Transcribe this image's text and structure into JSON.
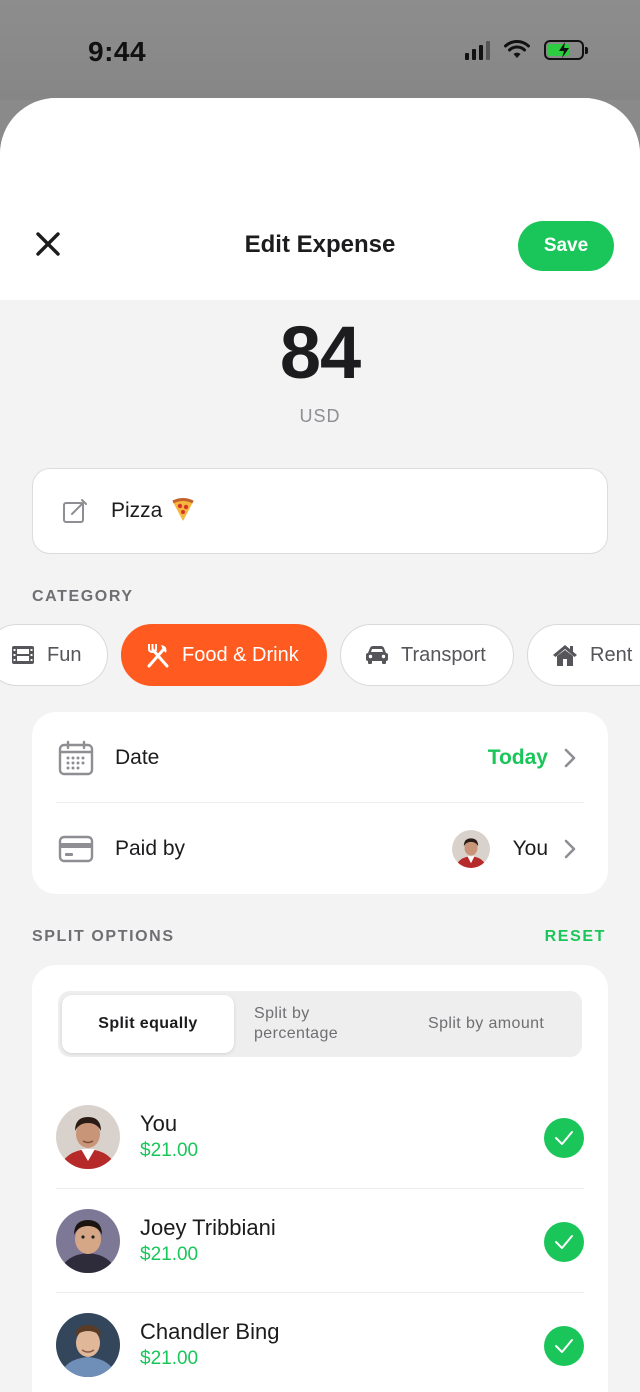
{
  "status_bar": {
    "time": "9:44"
  },
  "header": {
    "title": "Edit Expense",
    "save_label": "Save"
  },
  "expense": {
    "amount": "84",
    "currency": "USD",
    "description": "Pizza",
    "description_emoji": "🍕"
  },
  "category": {
    "label": "CATEGORY",
    "items": [
      {
        "label": "Fun",
        "icon": "film-icon"
      },
      {
        "label": "Food & Drink",
        "icon": "fork-knife-icon",
        "selected": true
      },
      {
        "label": "Transport",
        "icon": "car-icon"
      },
      {
        "label": "Rent",
        "icon": "house-icon"
      }
    ]
  },
  "details": {
    "date_label": "Date",
    "date_value": "Today",
    "paid_by_label": "Paid by",
    "paid_by_value": "You"
  },
  "split": {
    "label": "SPLIT OPTIONS",
    "reset_label": "RESET",
    "modes": [
      "Split equally",
      "Split by percentage",
      "Split by amount"
    ],
    "selected_mode": "Split equally",
    "members": [
      {
        "name": "You",
        "share": "$21.00",
        "checked": true
      },
      {
        "name": "Joey Tribbiani",
        "share": "$21.00",
        "checked": true
      },
      {
        "name": "Chandler Bing",
        "share": "$21.00",
        "checked": true
      }
    ]
  },
  "colors": {
    "accent_green": "#1ac65a",
    "accent_orange": "#ff5a1f",
    "background": "#f3f3f3"
  }
}
